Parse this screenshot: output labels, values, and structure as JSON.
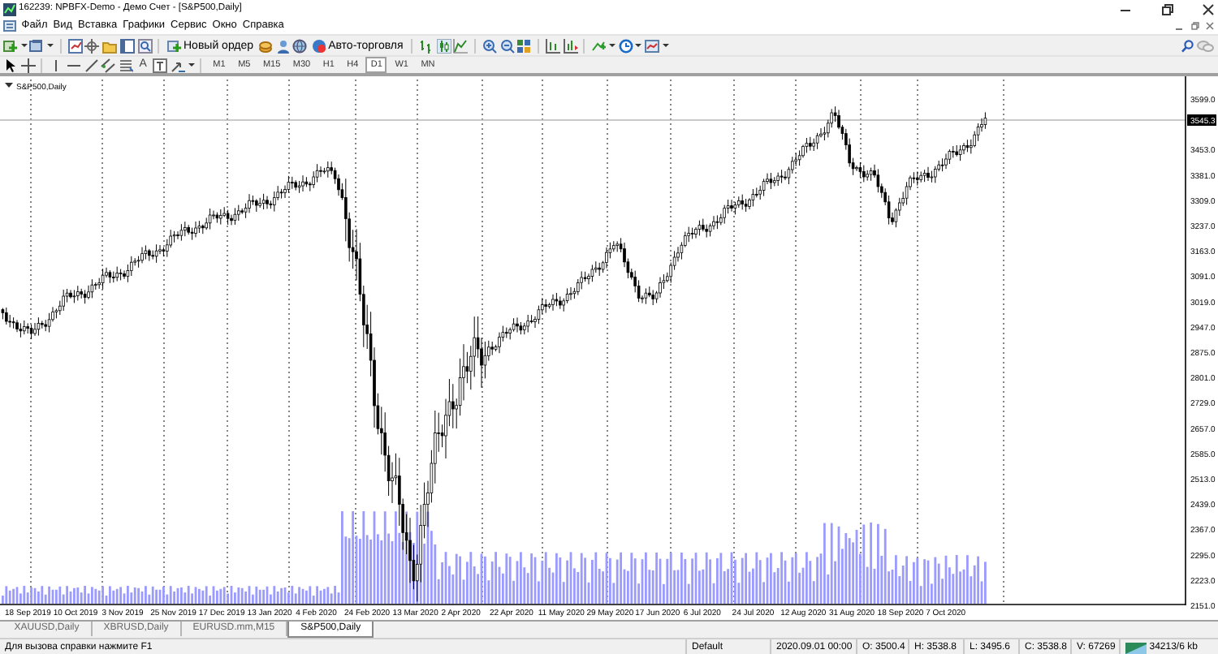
{
  "window": {
    "title": "162239: NPBFX-Demo - Демо Счет - [S&P500,Daily]"
  },
  "menu": [
    "Файл",
    "Вид",
    "Вставка",
    "Графики",
    "Сервис",
    "Окно",
    "Справка"
  ],
  "toolbar": {
    "new_order": "Новый ордер",
    "auto_trading": "Авто-торговля",
    "text_tool": "A"
  },
  "timeframes": [
    {
      "label": "M1",
      "selected": false
    },
    {
      "label": "M5",
      "selected": false
    },
    {
      "label": "M15",
      "selected": false
    },
    {
      "label": "M30",
      "selected": false
    },
    {
      "label": "H1",
      "selected": false
    },
    {
      "label": "H4",
      "selected": false
    },
    {
      "label": "D1",
      "selected": true
    },
    {
      "label": "W1",
      "selected": false
    },
    {
      "label": "MN",
      "selected": false
    }
  ],
  "chart": {
    "symbol_label": "S&P500,Daily",
    "current_price": "3545.3",
    "price_axis": [
      "3599.0",
      "3453.0",
      "3381.0",
      "3309.0",
      "3237.0",
      "3163.0",
      "3091.0",
      "3019.0",
      "2947.0",
      "2875.0",
      "2801.0",
      "2729.0",
      "2657.0",
      "2585.0",
      "2513.0",
      "2439.0",
      "2367.0",
      "2295.0",
      "2223.0",
      "2151.0"
    ],
    "date_axis": [
      "18 Sep 2019",
      "10 Oct 2019",
      "3 Nov 2019",
      "25 Nov 2019",
      "17 Dec 2019",
      "13 Jan 2020",
      "4 Feb 2020",
      "24 Feb 2020",
      "13 Mar 2020",
      "2 Apr 2020",
      "22 Apr 2020",
      "11 May 2020",
      "29 May 2020",
      "17 Jun 2020",
      "6 Jul 2020",
      "24 Jul 2020",
      "12 Aug 2020",
      "31 Aug 2020",
      "18 Sep 2020",
      "7 Oct 2020"
    ]
  },
  "tabs": [
    {
      "label": "XAUUSD,Daily",
      "selected": false
    },
    {
      "label": "XBRUSD,Daily",
      "selected": false
    },
    {
      "label": "EURUSD.mm,M15",
      "selected": false
    },
    {
      "label": "S&P500,Daily",
      "selected": true
    }
  ],
  "status_bar": {
    "help": "Для вызова справки нажмите F1",
    "profile": "Default",
    "time": "2020.09.01 00:00",
    "open": "O: 3500.4",
    "high": "H: 3538.8",
    "low": "L: 3495.6",
    "close": "C: 3538.8",
    "volume": "V: 67269",
    "traffic": "34213/6 kb"
  }
}
